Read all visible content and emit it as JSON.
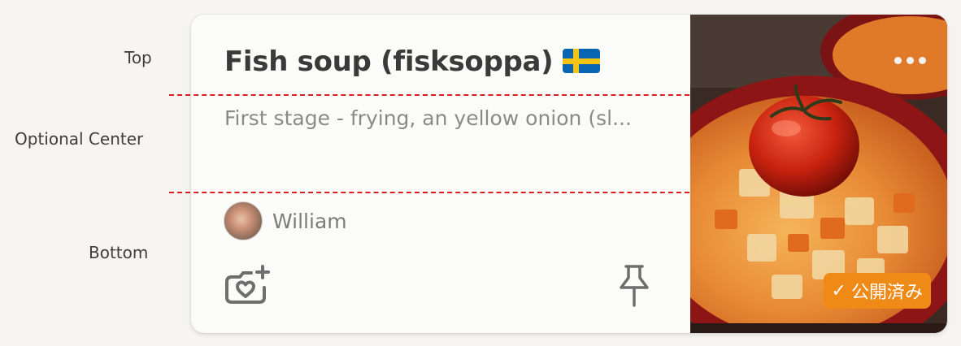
{
  "labels": {
    "top": "Top",
    "center": "Optional Center",
    "bottom": "Bottom"
  },
  "card": {
    "title": "Fish soup (fisksoppa)",
    "flag": "swedish-flag",
    "description": "First stage - frying, an yellow onion (sl...",
    "author": "William",
    "status_badge": "公開済み",
    "status_icon": "✓",
    "actions": {
      "photo_like": "camera-heart-icon",
      "pin": "pin-icon",
      "more": "more-dots-icon"
    }
  },
  "colors": {
    "guide_line": "#d71f1f",
    "badge": "#f08a17",
    "title": "#3a3a3a",
    "muted": "#8a8a8a"
  }
}
